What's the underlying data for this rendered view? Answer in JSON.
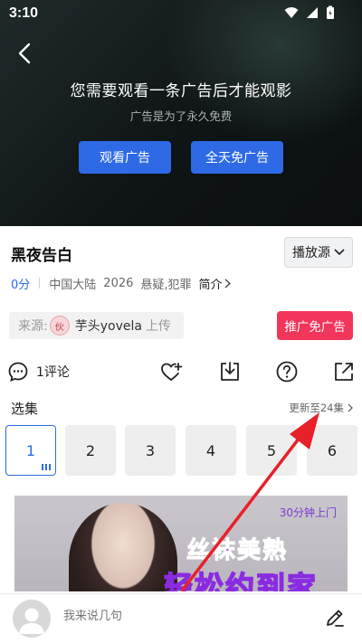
{
  "status": {
    "time": "3:10"
  },
  "player": {
    "ad_title": "您需要观看一条广告后才能观影",
    "ad_subtitle": "广告是为了永久免费",
    "watch_ad_label": "观看广告",
    "ad_free_label": "全天免广告"
  },
  "video": {
    "title": "黑夜告白",
    "source_label": "播放源",
    "score": "0分",
    "region": "中国大陆",
    "year": "2026",
    "genre": "悬疑,犯罪",
    "intro_label": "简介"
  },
  "uploader": {
    "prefix": "来源:",
    "avatar_text": "伙",
    "name": "芋头yovela",
    "suffix": "上传"
  },
  "promo_label": "推广免广告",
  "actions": {
    "comment_label": "1评论"
  },
  "episodes": {
    "label": "选集",
    "update_text": "更新至24集",
    "items": [
      "1",
      "2",
      "3",
      "4",
      "5",
      "6"
    ]
  },
  "banner": {
    "subtitle": "30分钟上门",
    "line1": "丝袜美熟",
    "line2": "轻松约到家"
  },
  "comment_bar": {
    "placeholder": "我来说几句"
  },
  "colors": {
    "accent": "#2e6ae6",
    "promo": "#f2355a",
    "arrow": "#e8202a"
  }
}
